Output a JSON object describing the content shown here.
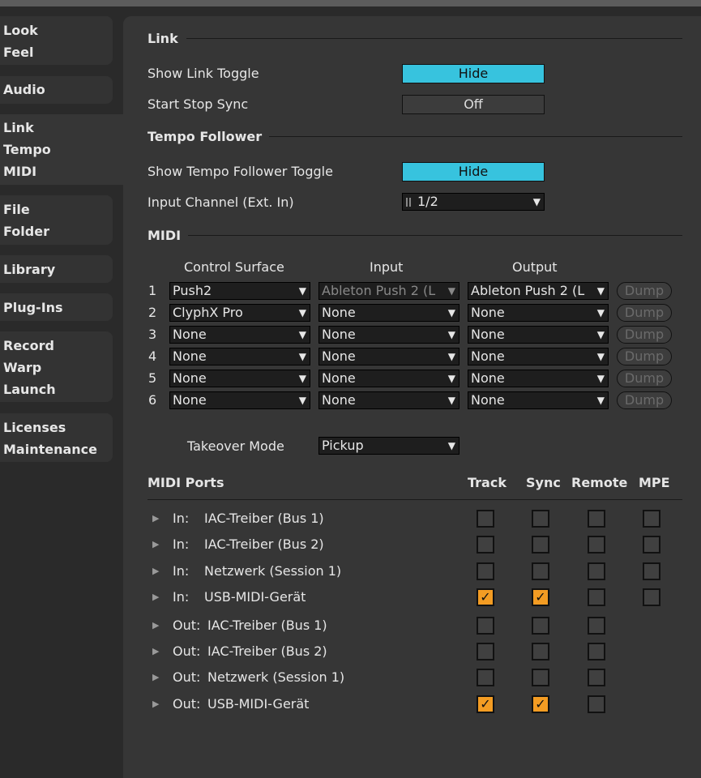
{
  "sidebar": {
    "groups": [
      [
        "Look",
        "Feel"
      ],
      [
        "Audio"
      ],
      [
        "Link",
        "Tempo",
        "MIDI"
      ],
      [
        "File",
        "Folder"
      ],
      [
        "Library"
      ],
      [
        "Plug-Ins"
      ],
      [
        "Record",
        "Warp",
        "Launch"
      ],
      [
        "Licenses",
        "Maintenance"
      ]
    ]
  },
  "link": {
    "title": "Link",
    "show_link_toggle": "Show Link Toggle",
    "show_link_value": "Hide",
    "start_stop_sync": "Start Stop Sync",
    "start_stop_value": "Off"
  },
  "tempo": {
    "title": "Tempo Follower",
    "show_toggle": "Show Tempo Follower Toggle",
    "show_toggle_value": "Hide",
    "input_channel": "Input Channel (Ext. In)",
    "input_channel_value": "1/2"
  },
  "midi": {
    "title": "MIDI",
    "headers": [
      "Control Surface",
      "Input",
      "Output"
    ],
    "dump": "Dump",
    "rows": [
      {
        "n": "1",
        "cs": "Push2",
        "in": "Ableton Push 2 (L",
        "out": "Ableton Push 2 (L"
      },
      {
        "n": "2",
        "cs": "ClyphX Pro",
        "in": "None",
        "out": "None"
      },
      {
        "n": "3",
        "cs": "None",
        "in": "None",
        "out": "None"
      },
      {
        "n": "4",
        "cs": "None",
        "in": "None",
        "out": "None"
      },
      {
        "n": "5",
        "cs": "None",
        "in": "None",
        "out": "None"
      },
      {
        "n": "6",
        "cs": "None",
        "in": "None",
        "out": "None"
      }
    ],
    "takeover_label": "Takeover Mode",
    "takeover_value": "Pickup"
  },
  "ports": {
    "title": "MIDI Ports",
    "cols": [
      "Track",
      "Sync",
      "Remote",
      "MPE"
    ],
    "rows": [
      {
        "dir": "In:",
        "name": "IAC-Treiber (Bus 1)",
        "checks": [
          false,
          false,
          false,
          false
        ]
      },
      {
        "dir": "In:",
        "name": "IAC-Treiber (Bus 2)",
        "checks": [
          false,
          false,
          false,
          false
        ]
      },
      {
        "dir": "In:",
        "name": "Netzwerk (Session 1)",
        "checks": [
          false,
          false,
          false,
          false
        ]
      },
      {
        "dir": "In:",
        "name": "USB-MIDI-Gerät",
        "checks": [
          true,
          true,
          false,
          false
        ]
      },
      {
        "dir": "Out:",
        "name": "IAC-Treiber (Bus 1)",
        "checks": [
          false,
          false,
          false
        ]
      },
      {
        "dir": "Out:",
        "name": "IAC-Treiber (Bus 2)",
        "checks": [
          false,
          false,
          false
        ]
      },
      {
        "dir": "Out:",
        "name": "Netzwerk (Session 1)",
        "checks": [
          false,
          false,
          false
        ]
      },
      {
        "dir": "Out:",
        "name": "USB-MIDI-Gerät",
        "checks": [
          true,
          true,
          false
        ]
      }
    ]
  },
  "colors": {
    "accent": "#37c3de",
    "check": "#f39c23"
  }
}
